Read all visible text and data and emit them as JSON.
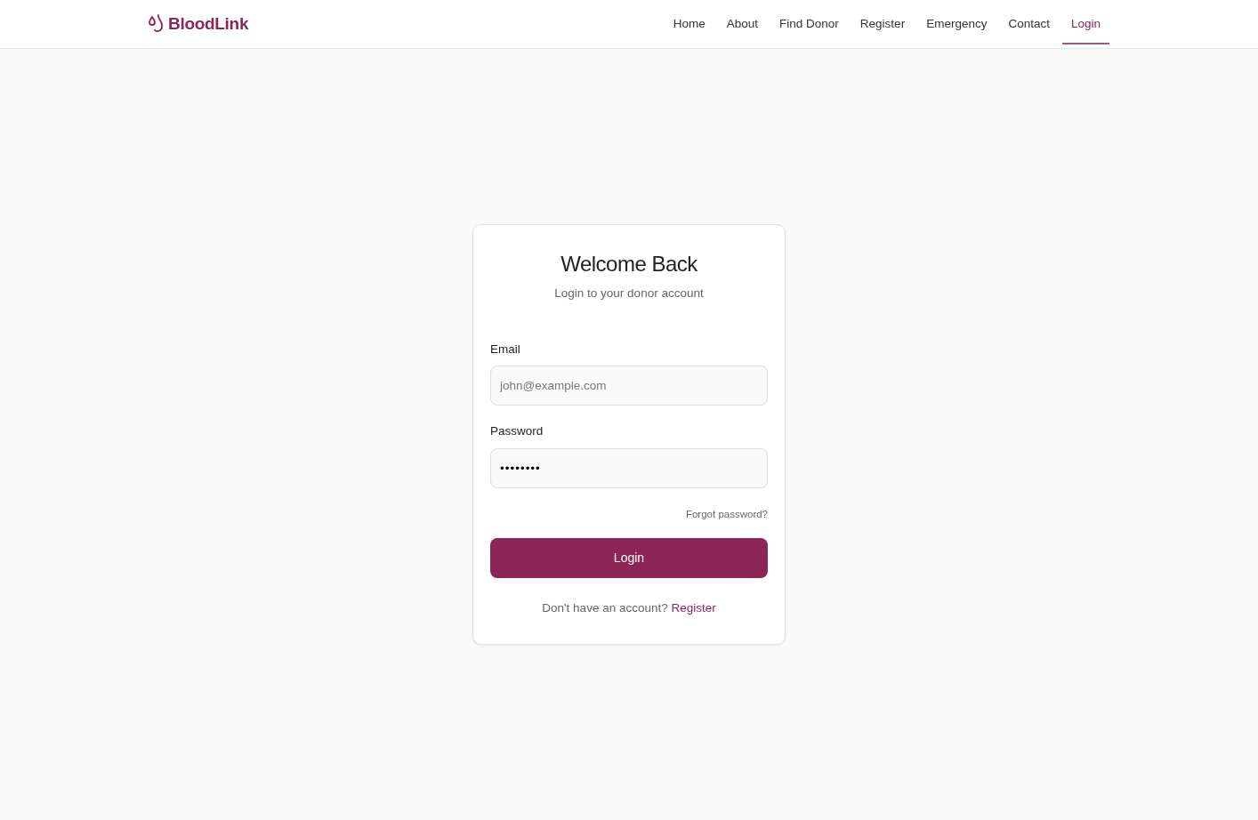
{
  "brand": {
    "name": "BloodLink"
  },
  "nav": [
    {
      "label": "Home",
      "selected": false
    },
    {
      "label": "About",
      "selected": false
    },
    {
      "label": "Find Donor",
      "selected": false
    },
    {
      "label": "Register",
      "selected": false
    },
    {
      "label": "Emergency",
      "selected": false
    },
    {
      "label": "Contact",
      "selected": false
    },
    {
      "label": "Login",
      "selected": true
    }
  ],
  "card": {
    "title": "Welcome Back",
    "subtitle": "Login to your donor account",
    "fields": [
      {
        "label": "Email",
        "placeholder": "john@example.com"
      },
      {
        "label": "Password",
        "value": "••••••••"
      }
    ],
    "forgot": "Forgot password?",
    "button": "Login",
    "footer_text": "Don't have an account?",
    "footer_link": "Register"
  }
}
